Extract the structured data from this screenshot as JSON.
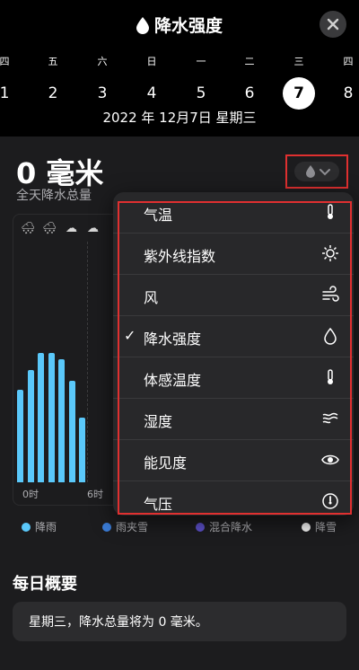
{
  "header": {
    "title": "降水强度",
    "weekdays": [
      "四",
      "五",
      "六",
      "日",
      "一",
      "二",
      "三",
      "四"
    ],
    "days": [
      "1",
      "2",
      "3",
      "4",
      "5",
      "6",
      "7",
      "8"
    ],
    "selected_day": "7",
    "date_line": "2022 年 12月7日  星期三"
  },
  "summary_value": "0 毫米",
  "summary_label": "全天降水总量",
  "chart_data": {
    "type": "bar",
    "x_ticks": [
      "0时",
      "6时"
    ],
    "values": [
      0.43,
      0.52,
      0.6,
      0.6,
      0.57,
      0.47,
      0.3,
      0.0
    ],
    "series_color": "#5ac8fa"
  },
  "weather_icons": [
    "rain-snow-icon",
    "rain-snow-icon",
    "cloud-icon",
    "cloud-icon"
  ],
  "legend": [
    {
      "label": "降雨",
      "color": "#5ac8fa"
    },
    {
      "label": "雨夹雪",
      "color": "#3a7bd5"
    },
    {
      "label": "混合降水",
      "color": "#5b4fc7"
    },
    {
      "label": "降雪",
      "color": "#f2f2f2"
    }
  ],
  "menu": {
    "items": [
      {
        "label": "气温",
        "icon": "thermometer-icon",
        "checked": false
      },
      {
        "label": "紫外线指数",
        "icon": "sun-icon",
        "checked": false
      },
      {
        "label": "风",
        "icon": "wind-icon",
        "checked": false
      },
      {
        "label": "降水强度",
        "icon": "drop-icon",
        "checked": true
      },
      {
        "label": "体感温度",
        "icon": "thermometer-icon",
        "checked": false
      },
      {
        "label": "湿度",
        "icon": "humidity-icon",
        "checked": false
      },
      {
        "label": "能见度",
        "icon": "eye-icon",
        "checked": false
      },
      {
        "label": "气压",
        "icon": "gauge-icon",
        "checked": false
      }
    ],
    "check_mark": "✓"
  },
  "daily_summary": {
    "title": "每日概要",
    "text": "星期三，降水总量将为 0 毫米。"
  }
}
